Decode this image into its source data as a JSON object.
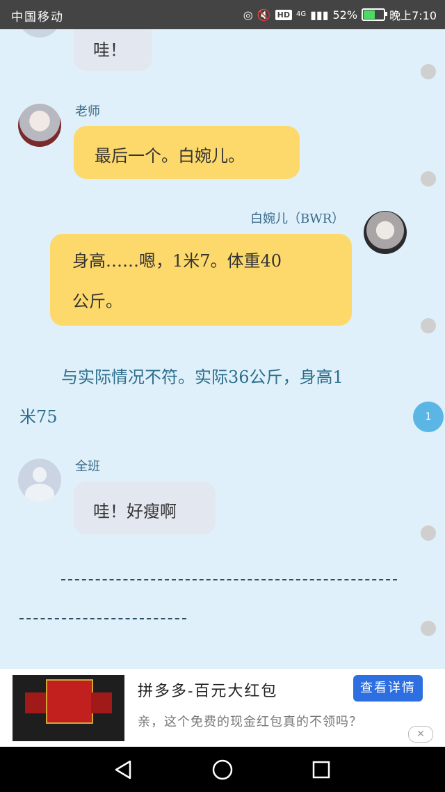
{
  "status_bar": {
    "carrier": "中国移动",
    "network": "4G",
    "hd": "HD",
    "battery": "52%",
    "time": "晚上7:10"
  },
  "messages": [
    {
      "text": "哇！"
    },
    {
      "sender": "老师",
      "text": "最后一个。白婉儿。"
    },
    {
      "sender": "白婉儿（BWR）",
      "text_line1": "身高……嗯，1米7。体重40",
      "text_line2": "公斤。"
    },
    {
      "narration_line1": "与实际情况不符。实际36公斤，身高1",
      "narration_line2": "米75"
    },
    {
      "sender": "全班",
      "text": "哇！好瘦啊"
    }
  ],
  "unread_counter": "1",
  "ad": {
    "title": "拼多多-百元大红包",
    "description": "亲，这个免费的现金红包真的不领吗？",
    "button": "查看详情",
    "close": "✕"
  },
  "nav": {
    "back_icon": "back-triangle-icon",
    "home_icon": "home-circle-icon",
    "recents_icon": "recents-square-icon"
  }
}
